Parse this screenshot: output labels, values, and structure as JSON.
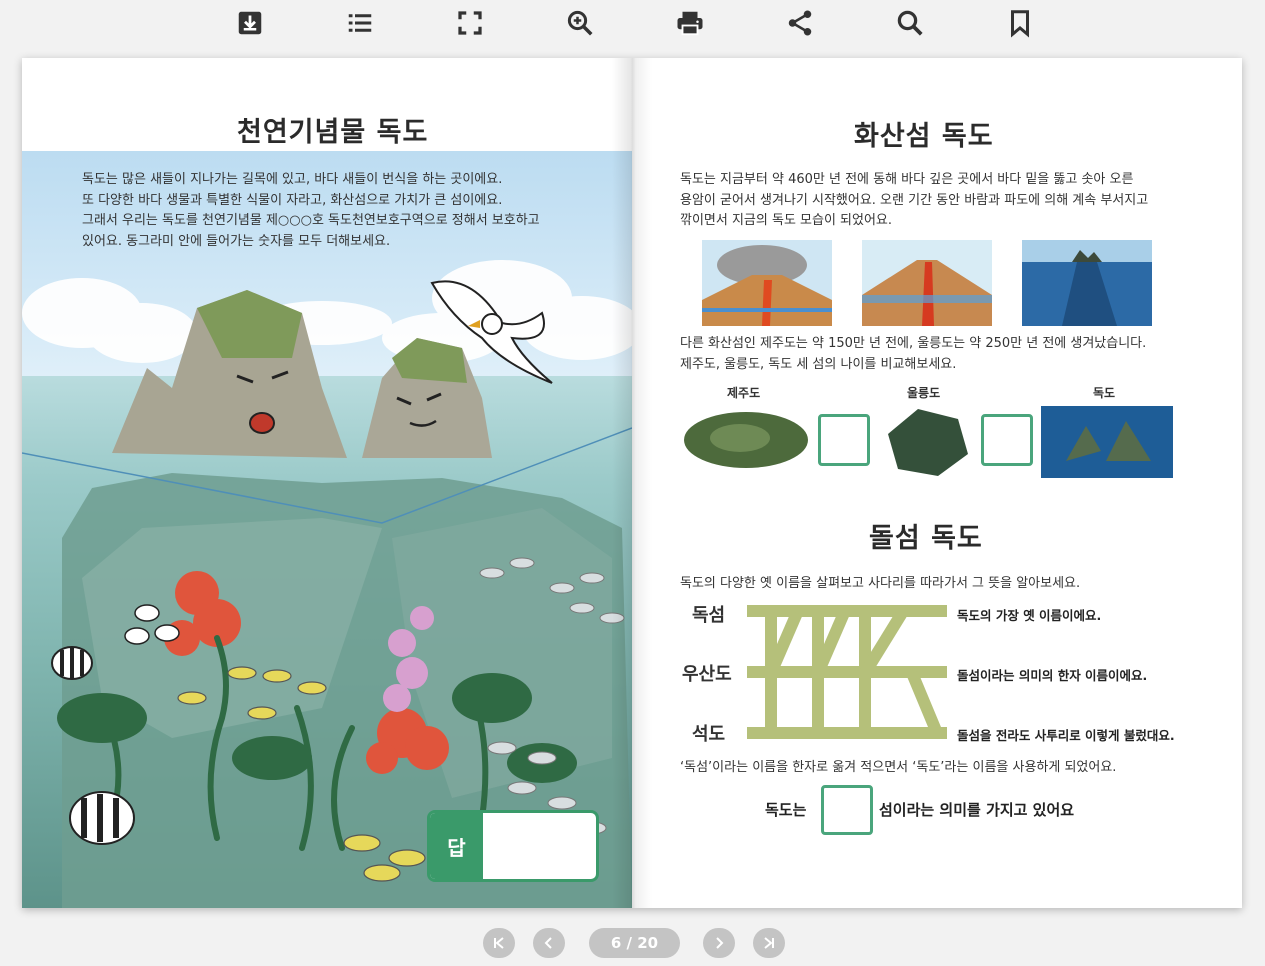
{
  "toolbar": {
    "icons": [
      "download-icon",
      "table-of-contents-icon",
      "fullscreen-icon",
      "zoom-in-icon",
      "print-icon",
      "share-icon",
      "search-icon",
      "bookmark-icon"
    ]
  },
  "left_page": {
    "title": "천연기념물 독도",
    "paragraph_lines": [
      "독도는 많은 새들이 지나가는 길목에 있고, 바다 새들이 번식을 하는 곳이에요.",
      "또 다양한 바다 생물과 특별한 식물이 자라고, 화산섬으로 가치가 큰 섬이에요.",
      "그래서 우리는 독도를 천연기념물 제○○○호 독도천연보호구역으로 정해서 보호하고",
      "있어요. 동그라미 안에 들어가는 숫자를 모두 더해보세요."
    ],
    "answer_label": "답"
  },
  "right_page": {
    "section1": {
      "title": "화산섬 독도",
      "paragraph_lines": [
        "독도는 지금부터 약 460만 년 전에 동해 바다 깊은 곳에서 바다 밑을 뚫고 솟아 오른",
        "용암이 굳어서 생겨나기 시작했어요. 오랜 기간 동안 바람과 파도에 의해 계속 부서지고",
        "깎이면서 지금의 독도 모습이 되었어요."
      ],
      "paragraph2_lines": [
        "다른 화산섬인 제주도는 약 150만 년 전에, 울릉도는 약 250만 년 전에 생겨났습니다.",
        "제주도, 울릉도, 독도 세 섬의 나이를 비교해보세요."
      ],
      "islands": [
        "제주도",
        "울릉도",
        "독도"
      ]
    },
    "section2": {
      "title": "돌섬 독도",
      "instruction": "독도의 다양한 옛 이름을 살펴보고 사다리를 따라가서 그 뜻을 알아보세요.",
      "ladder_names": [
        "독섬",
        "우산도",
        "석도"
      ],
      "ladder_descriptions": [
        "독도의 가장 옛 이름이에요.",
        "돌섬이라는 의미의 한자 이름이에요.",
        "돌섬을 전라도 사투리로 이렇게 불렀대요."
      ],
      "note": "‘독섬’이라는 이름을 한자로 옮겨 적으면서 ‘독도’라는 이름을 사용하게 되었어요.",
      "final_prefix": "독도는",
      "final_suffix": "섬이라는 의미를 가지고 있어요"
    }
  },
  "pagination": {
    "current": "6 / 20"
  },
  "colors": {
    "accent_green": "#3a9a6a",
    "ladder_green": "#b5c07a",
    "nav_gray": "#c4c4c4"
  }
}
